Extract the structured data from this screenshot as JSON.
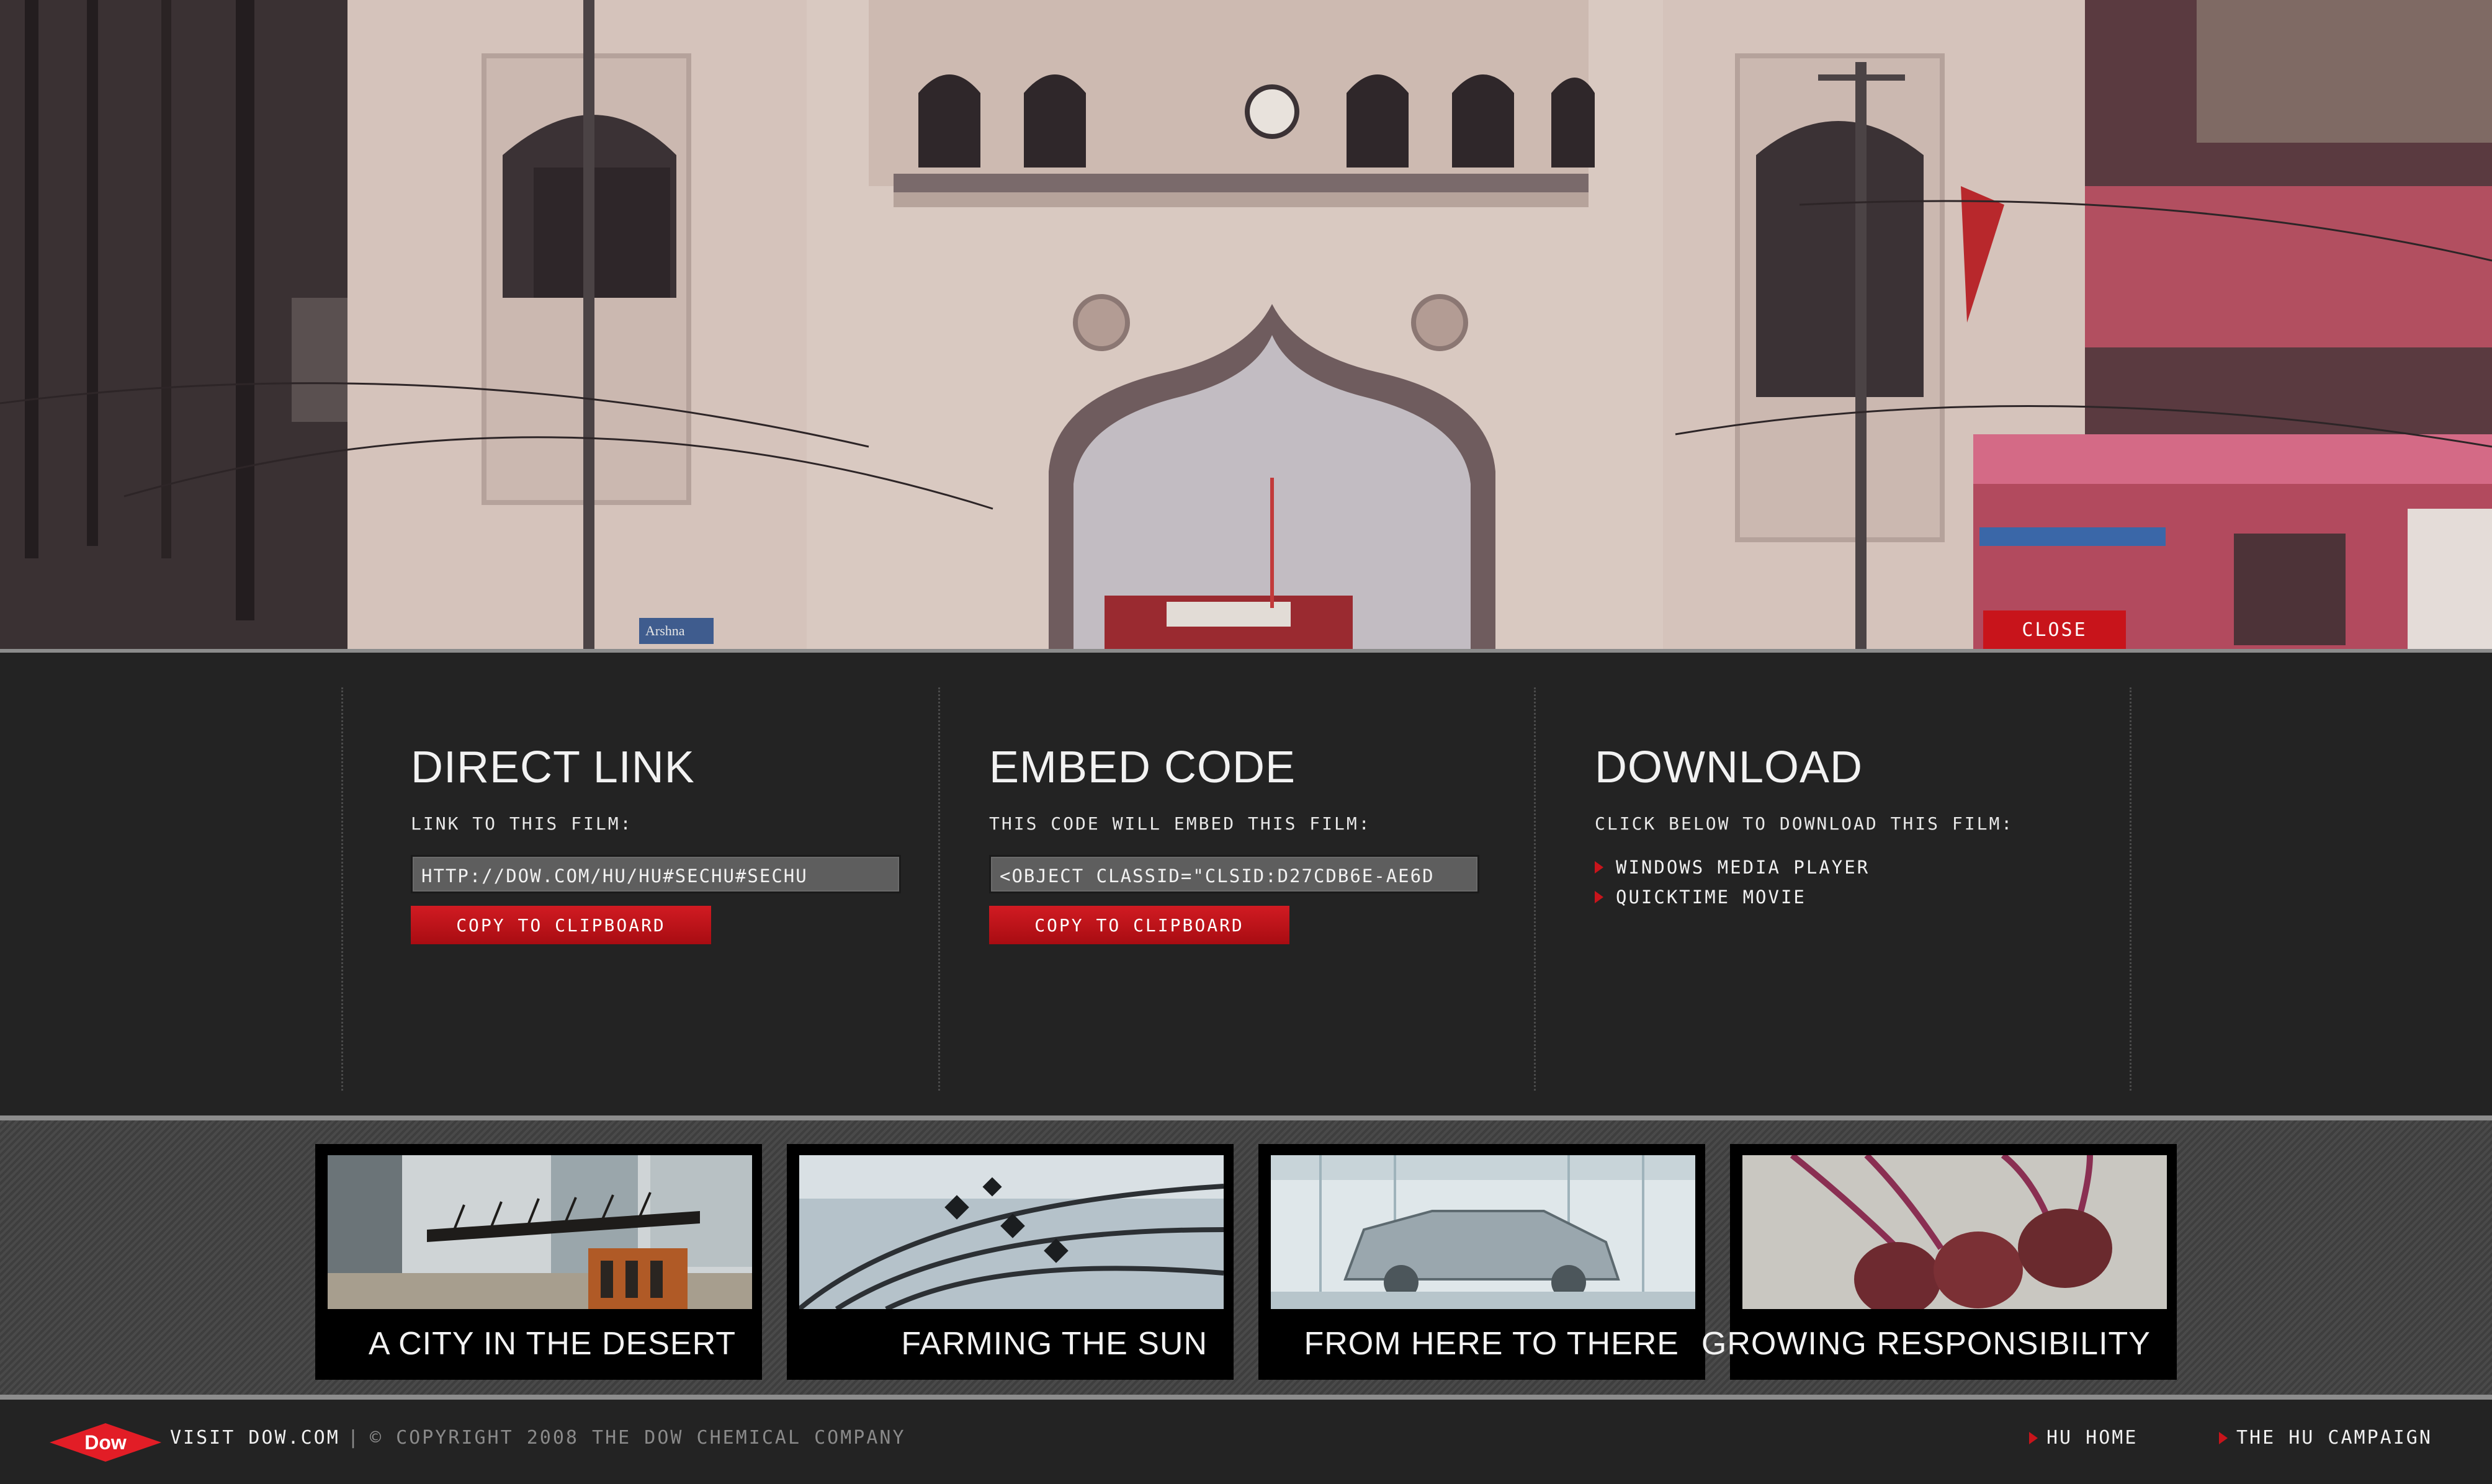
{
  "hero": {
    "close_label": "CLOSE",
    "sign_text": "Arshna"
  },
  "share": {
    "direct_link": {
      "heading": "DIRECT LINK",
      "subheading": "LINK TO THIS FILM:",
      "value": "HTTP://DOW.COM/HU/HU#SECHU#SECHU",
      "button": "COPY TO CLIPBOARD"
    },
    "embed_code": {
      "heading": "EMBED CODE",
      "subheading": "THIS CODE WILL EMBED THIS FILM:",
      "value": "<OBJECT CLASSID=\"CLSID:D27CDB6E-AE6D",
      "button": "COPY TO CLIPBOARD"
    },
    "download": {
      "heading": "DOWNLOAD",
      "subheading": "CLICK BELOW TO DOWNLOAD THIS FILM:",
      "items": [
        "WINDOWS MEDIA PLAYER",
        "QUICKTIME MOVIE"
      ]
    }
  },
  "films": [
    {
      "title": "A CITY IN THE DESERT"
    },
    {
      "title": "FARMING THE SUN"
    },
    {
      "title": "FROM HERE TO THERE"
    },
    {
      "title": "GROWING RESPONSIBILITY"
    }
  ],
  "footer": {
    "logo_text": "Dow",
    "visit_label": "VISIT DOW.COM",
    "separator": "|",
    "copyright": "© COPYRIGHT 2008 THE DOW CHEMICAL COMPANY",
    "nav": [
      "HU HOME",
      "THE HU CAMPAIGN"
    ]
  },
  "colors": {
    "accent_red": "#c8141b",
    "panel_bg": "#232323",
    "text_light": "#f1f1f1",
    "text_muted": "#8a8a8a"
  }
}
